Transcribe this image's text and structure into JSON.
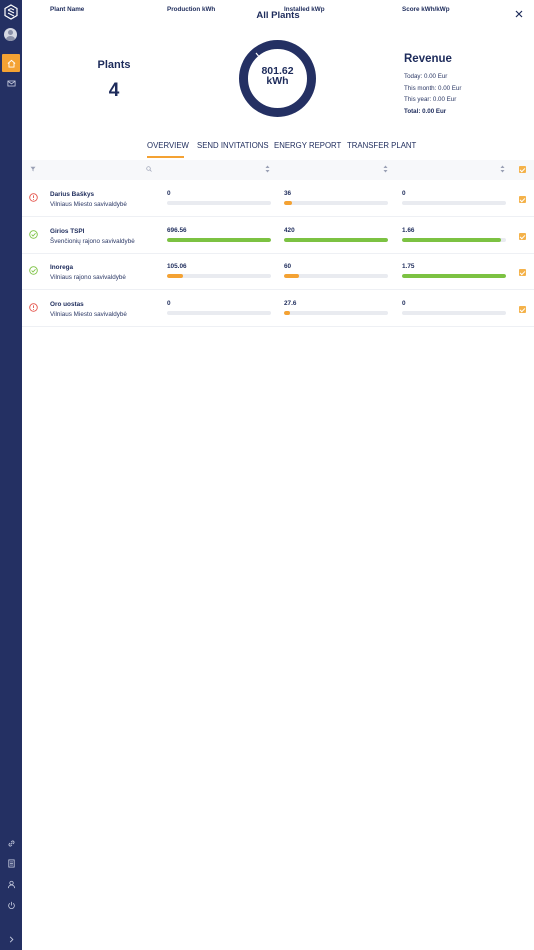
{
  "page": {
    "title": "All Plants"
  },
  "summary": {
    "plants_label": "Plants",
    "plants_count": "4",
    "energy_value": "801.62",
    "energy_unit": "kWh",
    "revenue": {
      "title": "Revenue",
      "today": "Today: 0.00 Eur",
      "month": "This month: 0.00 Eur",
      "year": "This year: 0.00 Eur",
      "total": "Total: 0.00 Eur"
    }
  },
  "tabs": [
    {
      "label": "OVERVIEW",
      "active": true
    },
    {
      "label": "SEND INVITATIONS",
      "active": false
    },
    {
      "label": "ENERGY REPORT",
      "active": false
    },
    {
      "label": "TRANSFER PLANT",
      "active": false
    }
  ],
  "table": {
    "columns": {
      "plant_name": "Plant Name",
      "production": "Production kWh",
      "installed": "Installed kWp",
      "score": "Score kWh/kWp"
    },
    "rows": [
      {
        "status": "error",
        "name": "Darius Baškys",
        "location": "Vilniaus Miesto savivaldybė",
        "production": "0",
        "production_fraction": 0,
        "installed": "36",
        "installed_fraction": 0.08,
        "score": "0",
        "score_fraction": 0
      },
      {
        "status": "ok",
        "name": "Girios TSPI",
        "location": "Švenčionių rajono savivaldybė",
        "production": "696.56",
        "production_fraction": 1.0,
        "installed": "420",
        "installed_fraction": 1.0,
        "score": "1.66",
        "score_fraction": 0.95
      },
      {
        "status": "ok",
        "name": "Inorega",
        "location": "Vilniaus rajono savivaldybė",
        "production": "105.06",
        "production_fraction": 0.15,
        "installed": "60",
        "installed_fraction": 0.14,
        "score": "1.75",
        "score_fraction": 1.0
      },
      {
        "status": "error",
        "name": "Oro uostas",
        "location": "Vilniaus Miesto savivaldybė",
        "production": "0",
        "production_fraction": 0,
        "installed": "27.6",
        "installed_fraction": 0.06,
        "score": "0",
        "score_fraction": 0
      }
    ]
  },
  "colors": {
    "sidebar": "#243063",
    "accent": "#f4a233",
    "navy": "#1d2b5b",
    "ok": "#7cc242",
    "error": "#e5534b",
    "bar_green": "#7cc242",
    "bar_orange": "#f4a233"
  },
  "icons": {
    "sidebar_top": [
      "logo-icon",
      "avatar"
    ],
    "sidebar_nav": [
      "home-icon",
      "mail-icon"
    ],
    "sidebar_bottom": [
      "link-icon",
      "document-icon",
      "user-icon",
      "power-icon",
      "chevron-right-icon"
    ]
  }
}
